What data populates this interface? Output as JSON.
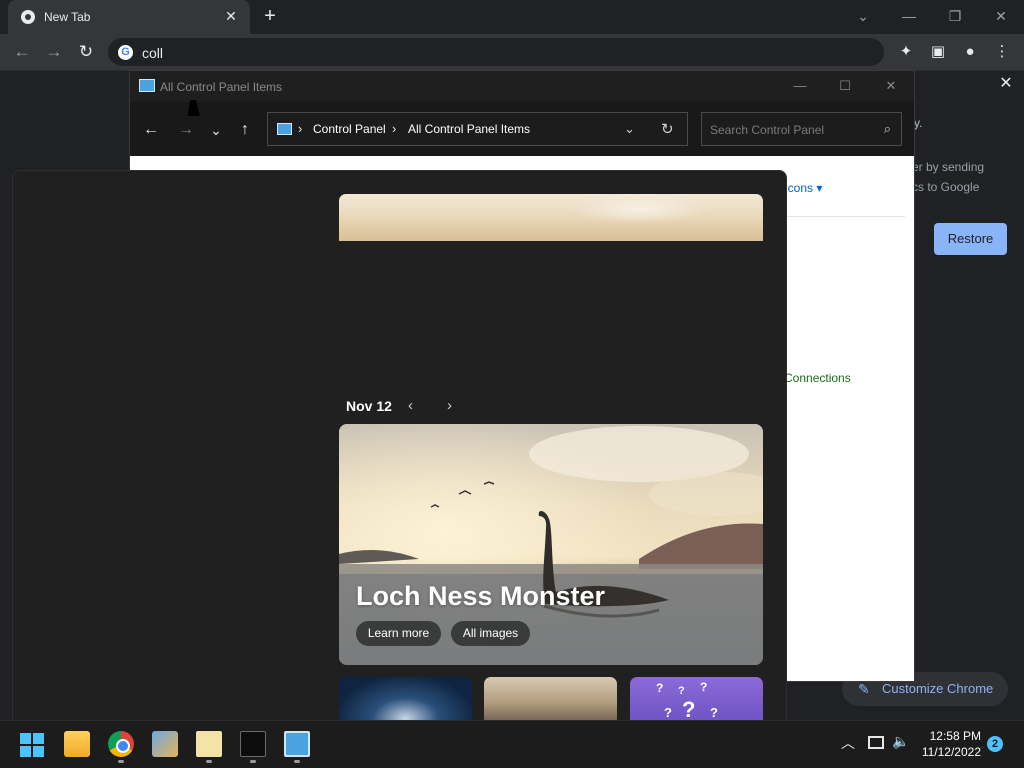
{
  "chrome": {
    "tab_title": "New Tab",
    "tab_close": "✕",
    "new_tab": "+",
    "window_controls": {
      "dropdown": "⌄",
      "minimize": "—",
      "restore": "❐",
      "close": "✕"
    },
    "toolbar": {
      "back": "←",
      "forward": "→",
      "reload": "↻"
    },
    "omnibox": {
      "value": "coll",
      "engine_icon": "G"
    },
    "toolbar_right": {
      "extensions": "✦",
      "side_panel": "▣",
      "profile": "●",
      "menu": "⋮"
    },
    "side_panel": {
      "close": "✕",
      "text1": "y.",
      "text2_line1": "er by sending",
      "text2_line2": "cs to Google",
      "restore_label": "Restore"
    },
    "customize_label": "Customize Chrome",
    "customize_icon": "✎"
  },
  "control_panel": {
    "title": "All Control Panel Items",
    "window_controls": {
      "minimize": "—",
      "maximize": "☐",
      "close": "✕"
    },
    "nav": {
      "back": "←",
      "forward": "→",
      "recent": "⌄",
      "up": "↑"
    },
    "breadcrumb": [
      "Control Panel",
      "All Control Panel Items"
    ],
    "breadcrumb_sep": "›",
    "address_dropdown": "⌄",
    "refresh": "↻",
    "search_placeholder": "Search Control Panel",
    "search_icon": "⌕",
    "view_by_value": "icons ▾",
    "connections_link": "Connections"
  },
  "widgets": {
    "date": "Nov 12",
    "prev": "‹",
    "next": "›",
    "hero_title": "Loch Ness Monster",
    "learn_more": "Learn more",
    "all_images": "All images",
    "thumb3_marks": [
      "?",
      "?",
      "?",
      "?",
      "?",
      "?"
    ]
  },
  "taskbar": {
    "apps": [
      "start",
      "file-explorer",
      "chrome",
      "paint",
      "notepad",
      "terminal",
      "control-panel"
    ],
    "tray": {
      "chevron": "︿",
      "volume": "🔈"
    },
    "time": "12:58 PM",
    "date": "11/12/2022",
    "notification_count": "2"
  }
}
